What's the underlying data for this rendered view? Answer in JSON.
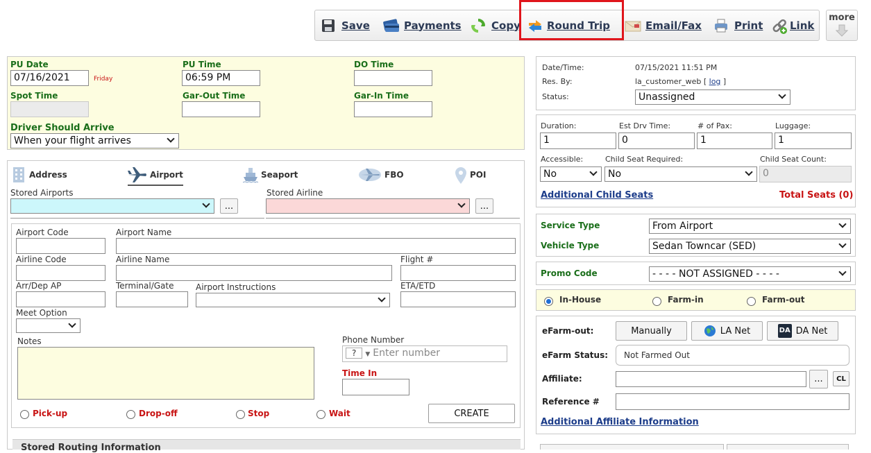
{
  "toolbar": {
    "items": [
      {
        "label": "Save",
        "icon": "floppy-icon"
      },
      {
        "label": "Payments",
        "icon": "credit-card-icon"
      },
      {
        "label": "Copy",
        "icon": "copy-recycle-icon"
      },
      {
        "label": "Round Trip",
        "icon": "round-trip-arrows-icon"
      },
      {
        "label": "Email/Fax",
        "icon": "envelope-icon"
      },
      {
        "label": "Print",
        "icon": "printer-icon"
      },
      {
        "label": "Link",
        "icon": "link-chain-icon"
      }
    ],
    "more_label": "more"
  },
  "trip": {
    "pu_date_label": "PU Date",
    "pu_date_value": "07/16/2021",
    "pu_day": "Friday",
    "pu_time_label": "PU Time",
    "pu_time_value": "06:59 PM",
    "do_time_label": "DO Time",
    "do_time_value": "",
    "spot_time_label": "Spot Time",
    "gar_out_label": "Gar-Out Time",
    "gar_in_label": "Gar-In Time",
    "driver_arrive_label": "Driver Should Arrive",
    "driver_arrive_value": "When your flight arrives"
  },
  "location_tabs": [
    "Address",
    "Airport",
    "Seaport",
    "FBO",
    "POI"
  ],
  "stored": {
    "airports_label": "Stored Airports",
    "airline_label": "Stored Airline",
    "ellipsis": "..."
  },
  "airport_form": {
    "airport_code": "Airport Code",
    "airport_name": "Airport Name",
    "airline_code": "Airline Code",
    "airline_name": "Airline Name",
    "flight_no": "Flight #",
    "arr_dep": "Arr/Dep AP",
    "terminal": "Terminal/Gate",
    "instructions": "Airport Instructions",
    "eta_etd": "ETA/ETD",
    "meet_option": "Meet Option",
    "notes": "Notes",
    "phone_label": "Phone Number",
    "phone_prefix": "?",
    "phone_placeholder": "Enter number",
    "time_in_label": "Time In",
    "create_label": "CREATE",
    "stop_types": [
      "Pick-up",
      "Drop-off",
      "Stop",
      "Wait"
    ],
    "stored_routing": "Stored Routing Information"
  },
  "info": {
    "datetime_label": "Date/Time:",
    "datetime_value": "07/15/2021 11:51 PM",
    "resby_label": "Res. By:",
    "resby_value": "la_customer_web [",
    "log_label": "log",
    "resby_close": "]",
    "status_label": "Status:",
    "status_value": "Unassigned"
  },
  "capacity": {
    "duration_label": "Duration:",
    "duration_value": "1",
    "est_drv_label": "Est Drv Time:",
    "est_drv_value": "0",
    "pax_label": "# of Pax:",
    "pax_value": "1",
    "luggage_label": "Luggage:",
    "luggage_value": "1",
    "accessible_label": "Accessible:",
    "accessible_value": "No",
    "child_seat_label": "Child Seat Required:",
    "child_seat_value": "No",
    "child_count_label": "Child Seat Count:",
    "child_count_value": "0",
    "additional_child_link": "Additional Child Seats",
    "total_seats": "Total Seats (0)"
  },
  "service": {
    "service_type_label": "Service Type",
    "service_type_value": "From Airport",
    "vehicle_type_label": "Vehicle Type",
    "vehicle_type_value": "Sedan Towncar (SED)"
  },
  "promo": {
    "label": "Promo Code",
    "value": "- - - - NOT ASSIGNED - - - -"
  },
  "farm": {
    "options": [
      "In-House",
      "Farm-in",
      "Farm-out"
    ],
    "selected": "In-House"
  },
  "efarm": {
    "efarm_out_label": "eFarm-out:",
    "manually_label": "Manually",
    "lanet_label": "LA Net",
    "danet_badge": "DA",
    "danet_label": "DA Net",
    "status_label": "eFarm Status:",
    "status_value": "Not Farmed Out",
    "affiliate_label": "Affiliate:",
    "cl_label": "CL",
    "reference_label": "Reference #",
    "additional_affiliate_link": "Additional Affiliate Information"
  },
  "colors": {
    "label_green": "#1a6e1a",
    "label_red": "#c81414",
    "link_blue": "#1d3d8a",
    "panel_yellow": "#fdfde0",
    "highlight_red": "#e0151c",
    "airport_cyan": "#ccf7fb",
    "airline_pink": "#fbd8d8"
  }
}
